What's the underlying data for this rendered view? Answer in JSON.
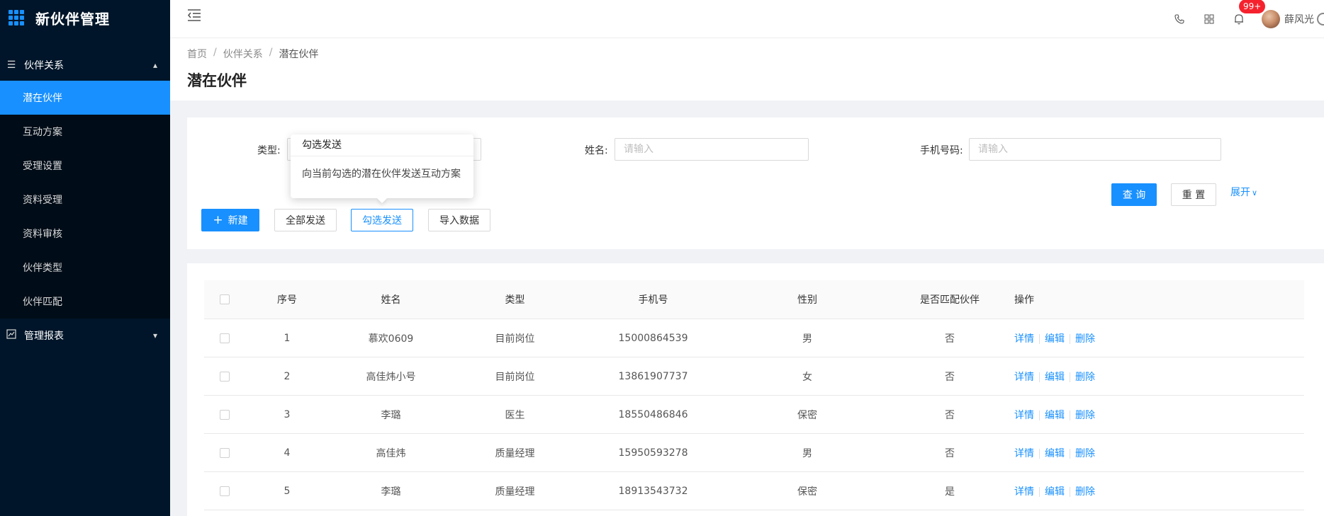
{
  "sidebar": {
    "app_title": "新伙伴管理",
    "groups": [
      {
        "label": "伙伴关系",
        "expanded": true,
        "items": [
          {
            "label": "潜在伙伴",
            "active": true
          },
          {
            "label": "互动方案"
          },
          {
            "label": "受理设置"
          },
          {
            "label": "资料受理"
          },
          {
            "label": "资料审核"
          },
          {
            "label": "伙伴类型"
          },
          {
            "label": "伙伴匹配"
          }
        ]
      },
      {
        "label": "管理报表",
        "expanded": false
      }
    ]
  },
  "header": {
    "notification_badge": "99+",
    "user_name": "薛风光"
  },
  "breadcrumb": [
    "首页",
    "伙伴关系",
    "潜在伙伴"
  ],
  "page_title": "潜在伙伴",
  "search": {
    "type_label": "类型:",
    "name_label": "姓名:",
    "name_placeholder": "请输入",
    "phone_label": "手机号码:",
    "phone_placeholder": "请输入",
    "query_label": "查 询",
    "reset_label": "重 置",
    "expand_label": "展开"
  },
  "tooltip": {
    "title": "勾选发送",
    "body": "向当前勾选的潜在伙伴发送互动方案"
  },
  "toolbar": {
    "new_label": "新建",
    "send_all_label": "全部发送",
    "send_selected_label": "勾选发送",
    "import_label": "导入数据"
  },
  "table": {
    "columns": [
      "序号",
      "姓名",
      "类型",
      "手机号",
      "性别",
      "是否匹配伙伴",
      "操作"
    ],
    "rows": [
      {
        "no": "1",
        "name": "慕欢0609",
        "type": "目前岗位",
        "phone": "15000864539",
        "gender": "男",
        "matched": "否"
      },
      {
        "no": "2",
        "name": "高佳炜小号",
        "type": "目前岗位",
        "phone": "13861907737",
        "gender": "女",
        "matched": "否"
      },
      {
        "no": "3",
        "name": "李璐",
        "type": "医生",
        "phone": "18550486846",
        "gender": "保密",
        "matched": "否"
      },
      {
        "no": "4",
        "name": "高佳炜",
        "type": "质量经理",
        "phone": "15950593278",
        "gender": "男",
        "matched": "否"
      },
      {
        "no": "5",
        "name": "李璐",
        "type": "质量经理",
        "phone": "18913543732",
        "gender": "保密",
        "matched": "是"
      }
    ],
    "actions": {
      "detail": "详情",
      "edit": "编辑",
      "delete": "删除"
    }
  },
  "colors": {
    "primary": "#1890ff",
    "sidebar_bg": "#001529",
    "submenu_bg": "#000c17",
    "badge": "#f5222d"
  }
}
